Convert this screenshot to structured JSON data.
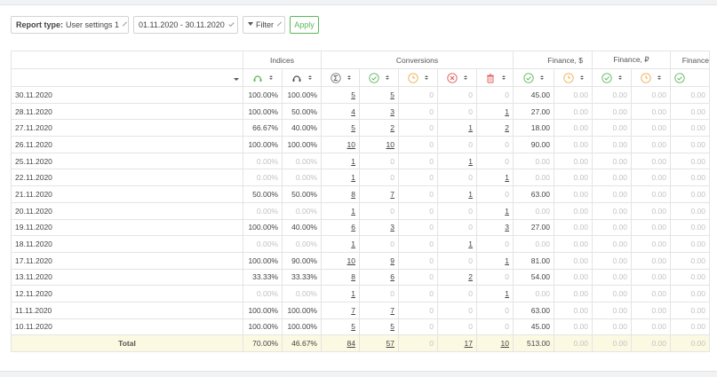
{
  "toolbar": {
    "report_type_label": "Report type:",
    "report_type_value": "User settings 1",
    "date_range": "01.11.2020 - 30.11.2020",
    "filter_label": "Filter",
    "apply_label": "Apply"
  },
  "groups": {
    "indices": "Indices",
    "conversions": "Conversions",
    "finance_usd": "Finance, $",
    "finance_rub": "Finance, ₽",
    "finance_more": "Finance"
  },
  "icons": {
    "indices": [
      "headset-green-icon",
      "headset-dark-icon"
    ],
    "conversions": [
      "sum-icon",
      "check-green-icon",
      "clock-orange-icon",
      "cross-red-icon",
      "trash-red-icon"
    ],
    "finance": [
      "check-green-icon",
      "clock-orange-icon"
    ]
  },
  "colors": {
    "green": "#5cb85c",
    "orange": "#f0ad4e",
    "red": "#e05a5a",
    "total_bg": "#fcf9e3"
  },
  "rows": [
    {
      "date": "30.11.2020",
      "i1": "100.00%",
      "i2": "100.00%",
      "c": [
        "5",
        "5",
        "0",
        "0",
        "0"
      ],
      "usd": [
        "45.00",
        "0.00"
      ],
      "rub": [
        "0.00",
        "0.00"
      ],
      "x": "0.00"
    },
    {
      "date": "28.11.2020",
      "i1": "100.00%",
      "i2": "50.00%",
      "c": [
        "4",
        "3",
        "0",
        "0",
        "1"
      ],
      "usd": [
        "27.00",
        "0.00"
      ],
      "rub": [
        "0.00",
        "0.00"
      ],
      "x": "0.00"
    },
    {
      "date": "27.11.2020",
      "i1": "66.67%",
      "i2": "40.00%",
      "c": [
        "5",
        "2",
        "0",
        "1",
        "2"
      ],
      "usd": [
        "18.00",
        "0.00"
      ],
      "rub": [
        "0.00",
        "0.00"
      ],
      "x": "0.00"
    },
    {
      "date": "26.11.2020",
      "i1": "100.00%",
      "i2": "100.00%",
      "c": [
        "10",
        "10",
        "0",
        "0",
        "0"
      ],
      "usd": [
        "90.00",
        "0.00"
      ],
      "rub": [
        "0.00",
        "0.00"
      ],
      "x": "0.00"
    },
    {
      "date": "25.11.2020",
      "i1": "0.00%",
      "i2": "0.00%",
      "c": [
        "1",
        "0",
        "0",
        "1",
        "0"
      ],
      "usd": [
        "0.00",
        "0.00"
      ],
      "rub": [
        "0.00",
        "0.00"
      ],
      "x": "0.00"
    },
    {
      "date": "22.11.2020",
      "i1": "0.00%",
      "i2": "0.00%",
      "c": [
        "1",
        "0",
        "0",
        "0",
        "1"
      ],
      "usd": [
        "0.00",
        "0.00"
      ],
      "rub": [
        "0.00",
        "0.00"
      ],
      "x": "0.00"
    },
    {
      "date": "21.11.2020",
      "i1": "50.00%",
      "i2": "50.00%",
      "c": [
        "8",
        "7",
        "0",
        "1",
        "0"
      ],
      "usd": [
        "63.00",
        "0.00"
      ],
      "rub": [
        "0.00",
        "0.00"
      ],
      "x": "0.00"
    },
    {
      "date": "20.11.2020",
      "i1": "0.00%",
      "i2": "0.00%",
      "c": [
        "1",
        "0",
        "0",
        "0",
        "1"
      ],
      "usd": [
        "0.00",
        "0.00"
      ],
      "rub": [
        "0.00",
        "0.00"
      ],
      "x": "0.00"
    },
    {
      "date": "19.11.2020",
      "i1": "100.00%",
      "i2": "40.00%",
      "c": [
        "6",
        "3",
        "0",
        "0",
        "3"
      ],
      "usd": [
        "27.00",
        "0.00"
      ],
      "rub": [
        "0.00",
        "0.00"
      ],
      "x": "0.00"
    },
    {
      "date": "18.11.2020",
      "i1": "0.00%",
      "i2": "0.00%",
      "c": [
        "1",
        "0",
        "0",
        "1",
        "0"
      ],
      "usd": [
        "0.00",
        "0.00"
      ],
      "rub": [
        "0.00",
        "0.00"
      ],
      "x": "0.00"
    },
    {
      "date": "17.11.2020",
      "i1": "100.00%",
      "i2": "90.00%",
      "c": [
        "10",
        "9",
        "0",
        "0",
        "1"
      ],
      "usd": [
        "81.00",
        "0.00"
      ],
      "rub": [
        "0.00",
        "0.00"
      ],
      "x": "0.00"
    },
    {
      "date": "13.11.2020",
      "i1": "33.33%",
      "i2": "33.33%",
      "c": [
        "8",
        "6",
        "0",
        "2",
        "0"
      ],
      "usd": [
        "54.00",
        "0.00"
      ],
      "rub": [
        "0.00",
        "0.00"
      ],
      "x": "0.00"
    },
    {
      "date": "12.11.2020",
      "i1": "0.00%",
      "i2": "0.00%",
      "c": [
        "1",
        "0",
        "0",
        "0",
        "1"
      ],
      "usd": [
        "0.00",
        "0.00"
      ],
      "rub": [
        "0.00",
        "0.00"
      ],
      "x": "0.00"
    },
    {
      "date": "11.11.2020",
      "i1": "100.00%",
      "i2": "100.00%",
      "c": [
        "7",
        "7",
        "0",
        "0",
        "0"
      ],
      "usd": [
        "63.00",
        "0.00"
      ],
      "rub": [
        "0.00",
        "0.00"
      ],
      "x": "0.00"
    },
    {
      "date": "10.11.2020",
      "i1": "100.00%",
      "i2": "100.00%",
      "c": [
        "5",
        "5",
        "0",
        "0",
        "0"
      ],
      "usd": [
        "45.00",
        "0.00"
      ],
      "rub": [
        "0.00",
        "0.00"
      ],
      "x": "0.00"
    }
  ],
  "total": {
    "date": "Total",
    "i1": "70.00%",
    "i2": "46.67%",
    "c": [
      "84",
      "57",
      "0",
      "17",
      "10"
    ],
    "usd": [
      "513.00",
      "0.00"
    ],
    "rub": [
      "0.00",
      "0.00"
    ],
    "x": "0.00"
  }
}
